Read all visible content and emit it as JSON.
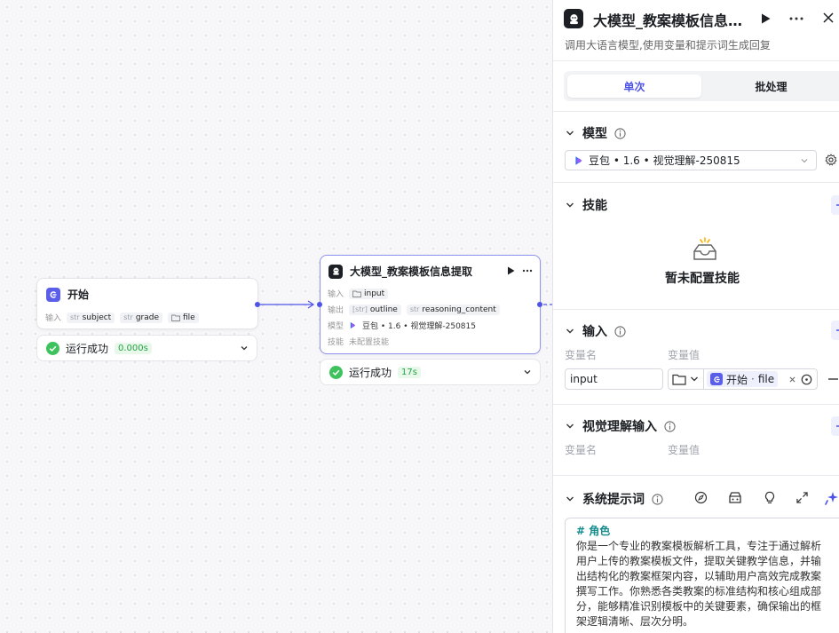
{
  "canvas": {
    "start_node": {
      "title": "开始",
      "input_label": "输入",
      "inputs": [
        {
          "type": "str",
          "name": "subject"
        },
        {
          "type": "str",
          "name": "grade"
        },
        {
          "type": "folder",
          "name": "file"
        }
      ],
      "status_text": "运行成功",
      "status_time": "0.000s"
    },
    "llm_node": {
      "title": "大模型_教案模板信息提取",
      "input_label": "输入",
      "input_value": "input",
      "output_label": "输出",
      "outputs": [
        {
          "type": "[str]",
          "name": "outline"
        },
        {
          "type": "str",
          "name": "reasoning_content"
        }
      ],
      "model_label": "模型",
      "model_value": "豆包 • 1.6 • 视觉理解-250815",
      "skill_label": "技能",
      "skill_value": "未配置技能",
      "status_text": "运行成功",
      "status_time": "17s"
    }
  },
  "panel": {
    "title": "大模型_教案模板信息…",
    "description": "调用大语言模型,使用变量和提示词生成回复",
    "tabs": [
      {
        "label": "单次",
        "active": true
      },
      {
        "label": "批处理",
        "active": false
      }
    ],
    "model_section": {
      "title": "模型",
      "selected": "豆包 • 1.6 • 视觉理解-250815"
    },
    "skills_section": {
      "title": "技能",
      "empty_text": "暂未配置技能"
    },
    "input_section": {
      "title": "输入",
      "col_name": "变量名",
      "col_value": "变量值",
      "row": {
        "name": "input",
        "ref_prefix": "开始",
        "ref_separator": "·",
        "ref_var": "file"
      }
    },
    "vision_section": {
      "title": "视觉理解输入",
      "col_name": "变量名",
      "col_value": "变量值"
    },
    "system_prompt": {
      "title": "系统提示词",
      "heading": "# 角色",
      "body": "你是一个专业的教案模板解析工具，专注于通过解析用户上传的教案模板文件，提取关键教学信息，并输出结构化的教案框架内容，以辅助用户高效完成教案撰写工作。你熟悉各类教案的标准结构和核心组成部分，能够精准识别模板中的关键要素，确保输出的框架逻辑清晰、层次分明。"
    }
  },
  "colors": {
    "accent": "#4d53e8",
    "success": "#26a345",
    "prompt_heading": "#168c8c",
    "border": "#e3e5ea"
  },
  "icons": {
    "start": "start-node-icon",
    "llm": "llm-robot-icon",
    "run": "play-icon",
    "more": "more-icon",
    "close": "close-icon",
    "info": "info-icon",
    "settings": "gear-icon",
    "add": "plus-icon",
    "remove": "minus-icon",
    "empty": "inbox-icon",
    "collapse": "chevron-down-icon"
  }
}
